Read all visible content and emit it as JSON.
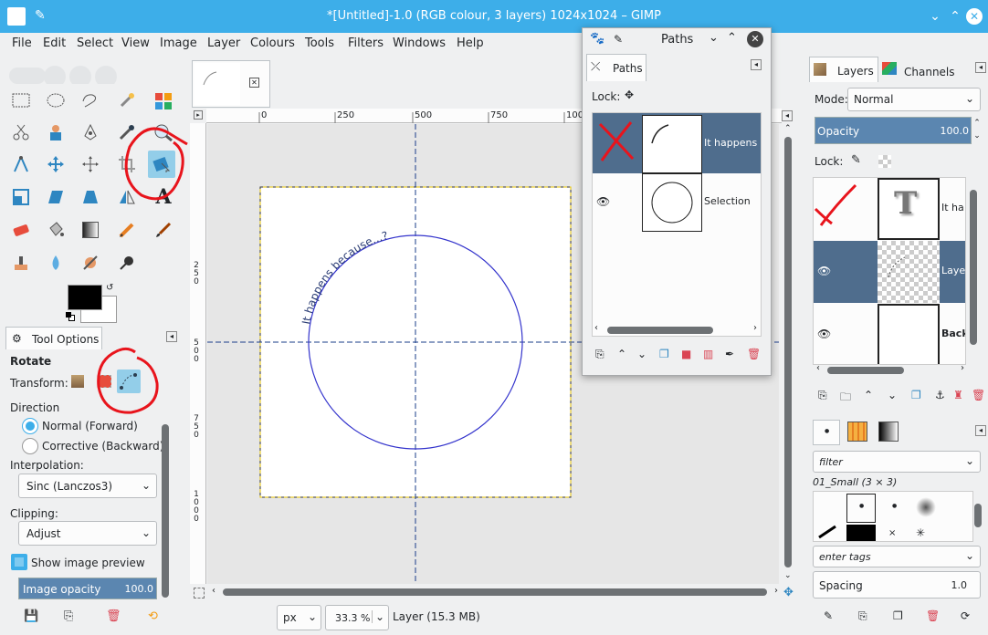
{
  "window": {
    "title": "*[Untitled]-1.0 (RGB colour, 3 layers) 1024x1024 – GIMP"
  },
  "menu": [
    "File",
    "Edit",
    "Select",
    "View",
    "Image",
    "Layer",
    "Colours",
    "Tools",
    "Filters",
    "Windows",
    "Help"
  ],
  "tool_options": {
    "tab_label": "Tool Options",
    "tool_name": "Rotate",
    "transform_label": "Transform:",
    "direction_label": "Direction",
    "direction_normal": "Normal (Forward)",
    "direction_corrective": "Corrective (Backward)",
    "interpolation_label": "Interpolation:",
    "interpolation_value": "Sinc (Lanczos3)",
    "clipping_label": "Clipping:",
    "clipping_value": "Adjust",
    "show_preview_label": "Show image preview",
    "image_opacity_label": "Image opacity",
    "image_opacity_value": "100.0"
  },
  "rulers": {
    "h_ticks": [
      "0",
      "250",
      "500",
      "750",
      "100"
    ],
    "v_ticks": [
      "2\n5\n0",
      "5\n0\n0",
      "7\n5\n0",
      "1\n0\n0\n0"
    ]
  },
  "canvas": {
    "text_on_path": "It happens because...?"
  },
  "status": {
    "unit": "px",
    "zoom": "33.3 %",
    "info": "Layer (15.3 MB)"
  },
  "paths_dialog": {
    "title": "Paths",
    "tab_label": "Paths",
    "lock_label": "Lock:",
    "items": [
      {
        "name": "It happens b",
        "selected": true
      },
      {
        "name": "Selection",
        "selected": false
      }
    ]
  },
  "layers": {
    "tab_layers": "Layers",
    "tab_channels": "Channels",
    "mode_label": "Mode:",
    "mode_value": "Normal",
    "opacity_label": "Opacity",
    "opacity_value": "100.0",
    "lock_label": "Lock:",
    "items": [
      {
        "name": "It ha",
        "type": "text"
      },
      {
        "name": "Laye",
        "type": "layer",
        "selected": true
      },
      {
        "name": "Back",
        "type": "background"
      }
    ]
  },
  "brushes": {
    "filter_placeholder": "filter",
    "brush_name": "01_Small (3 × 3)",
    "tags_placeholder": "enter tags",
    "spacing_label": "Spacing",
    "spacing_value": "1.0"
  },
  "colors": {
    "accent": "#3daee9",
    "selection": "#4f6d8d",
    "path_line": "#3333cc",
    "annotation": "#e8141c"
  }
}
